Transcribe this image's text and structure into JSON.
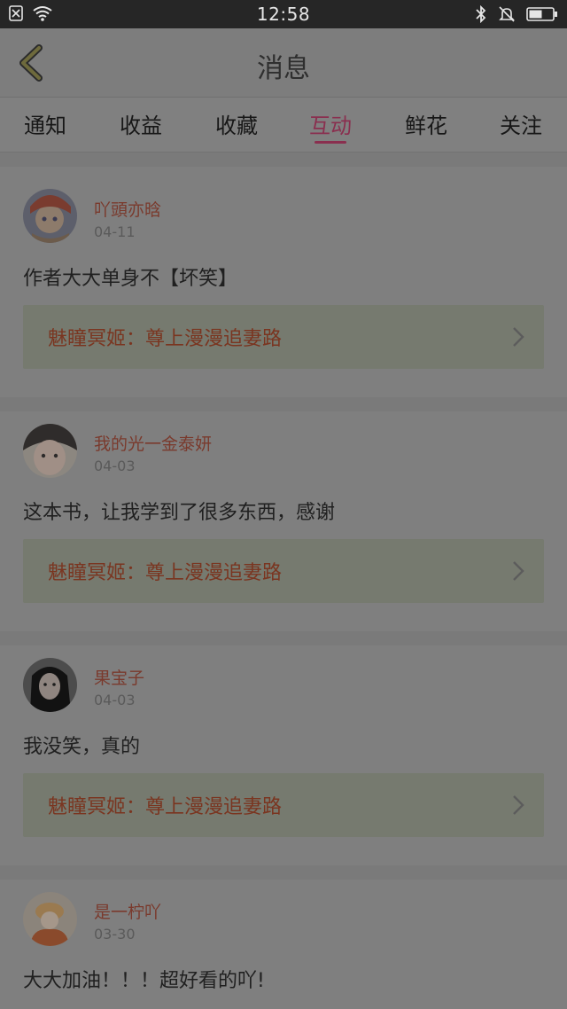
{
  "status_bar": {
    "time": "12:58"
  },
  "header": {
    "title": "消息"
  },
  "tabs": [
    {
      "label": "通知"
    },
    {
      "label": "收益"
    },
    {
      "label": "收藏"
    },
    {
      "label": "互动"
    },
    {
      "label": "鲜花"
    },
    {
      "label": "关注"
    }
  ],
  "active_tab": "互动",
  "colors": {
    "accent": "#8a2f4f",
    "username": "#7a3a2d",
    "book": "#7a3520"
  },
  "messages": [
    {
      "user": "吖頭亦晗",
      "date": "04-11",
      "comment": "作者大大单身不【坏笑】",
      "book": "魅瞳冥姬：尊上漫漫追妻路"
    },
    {
      "user": "我的光一金泰妍",
      "date": "04-03",
      "comment": "这本书，让我学到了很多东西，感谢",
      "book": "魅瞳冥姬：尊上漫漫追妻路"
    },
    {
      "user": "果宝子",
      "date": "04-03",
      "comment": "我没笑，真的",
      "book": "魅瞳冥姬：尊上漫漫追妻路"
    },
    {
      "user": "是一柠吖",
      "date": "03-30",
      "comment": "大大加油！！！超好看的吖!",
      "book": ""
    }
  ]
}
